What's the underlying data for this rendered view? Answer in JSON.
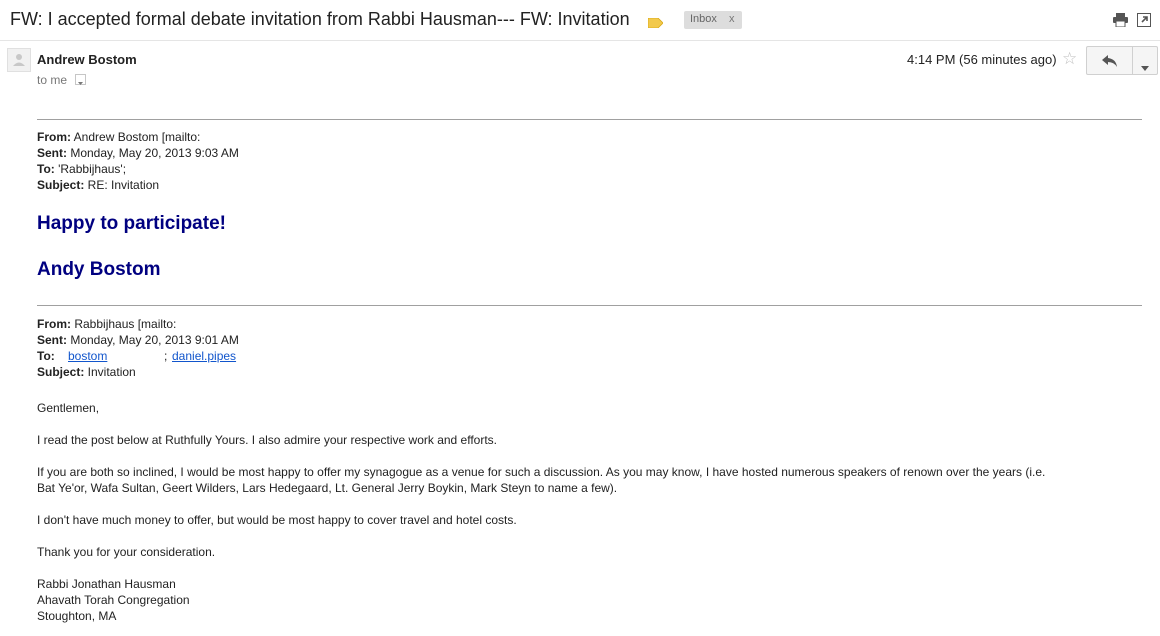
{
  "thread": {
    "subject": "FW: I accepted formal debate invitation from Rabbi Hausman--- FW: Invitation",
    "label": "Inbox",
    "label_remove": "x",
    "colors": {
      "label_tag": "#f2c94c",
      "label_chip": "#dddddd"
    }
  },
  "toolbar": {
    "print_icon": "printer-icon",
    "newwindow_icon": "new-window-icon"
  },
  "message": {
    "sender": "Andrew Bostom",
    "recipient": "to me",
    "timestamp": "4:14 PM (56 minutes ago)",
    "star_icon": "☆",
    "reply_icon": "reply-icon",
    "more_icon": "chevron-down-icon"
  },
  "fwd1": {
    "from_label": "From:",
    "from_value": " Andrew Bostom [mailto:",
    "sent_label": "Sent:",
    "sent_value": " Monday, May 20, 2013 9:03 AM",
    "to_label": "To:",
    "to_value": " 'Rabbijhaus';",
    "subject_label": "Subject:",
    "subject_value": " RE: Invitation"
  },
  "reply": {
    "line1": "Happy to participate!",
    "line2": "Andy Bostom",
    "color": "#000080"
  },
  "fwd2": {
    "from_label": "From:",
    "from_value": " Rabbijhaus [mailto:",
    "sent_label": "Sent:",
    "sent_value": " Monday, May 20, 2013 9:01 AM",
    "to_label": "To:",
    "to_link1": "bostom",
    "to_sep": ";",
    "to_link2": "daniel.pipes",
    "subject_label": "Subject:",
    "subject_value": " Invitation"
  },
  "letter": {
    "greeting": "Gentlemen,",
    "p1": "I read the post below at Ruthfully Yours.  I also admire your respective work and efforts.",
    "p2a": "If you are both so inclined, I would be most happy to offer my synagogue as a venue for such a discussion.  As you may know, I have hosted numerous speakers of renown over the years (i.e.",
    "p2b": "Bat Ye'or, Wafa Sultan, Geert Wilders, Lars Hedegaard, Lt. General Jerry Boykin, Mark Steyn to name a few).",
    "p3": "I don't have much money to offer, but would be most happy to cover travel and hotel costs.",
    "p4": "Thank you for your consideration.",
    "sig1": "Rabbi Jonathan Hausman",
    "sig2": "Ahavath Torah Congregation",
    "sig3": "Stoughton, MA"
  }
}
